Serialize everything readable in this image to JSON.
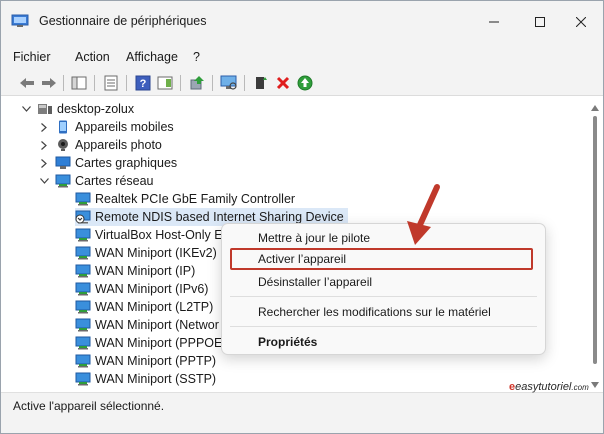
{
  "window": {
    "title": "Gestionnaire de périphériques"
  },
  "menubar": {
    "items": [
      "Fichier",
      "Action",
      "Affichage",
      "?"
    ]
  },
  "toolbar": {
    "icons": [
      "back-icon",
      "forward-icon",
      "show-hide-tree-icon",
      "properties-icon",
      "help-icon",
      "view-icon",
      "update-driver-icon",
      "scan-hardware-icon",
      "enable-device-icon",
      "uninstall-icon",
      "add-driver-icon"
    ]
  },
  "tree": {
    "root": "desktop-zolux",
    "categories": [
      {
        "label": "Appareils mobiles",
        "expanded": false
      },
      {
        "label": "Appareils photo",
        "expanded": false
      },
      {
        "label": "Cartes graphiques",
        "expanded": false
      },
      {
        "label": "Cartes réseau",
        "expanded": true
      }
    ],
    "network_devices": [
      "Realtek PCIe GbE Family Controller",
      "Remote NDIS based Internet Sharing Device",
      "VirtualBox Host-Only Et",
      "WAN Miniport (IKEv2)",
      "WAN Miniport (IP)",
      "WAN Miniport (IPv6)",
      "WAN Miniport (L2TP)",
      "WAN Miniport (Networ",
      "WAN Miniport (PPPOE)",
      "WAN Miniport (PPTP)",
      "WAN Miniport (SSTP)"
    ]
  },
  "context_menu": {
    "items": [
      "Mettre à jour le pilote",
      "Activer l’appareil",
      "Désinstaller l’appareil",
      "Rechercher les modifications sur le matériel",
      "Propriétés"
    ]
  },
  "status": {
    "text": "Active l'appareil sélectionné."
  },
  "watermark": {
    "text": "easytutoriel",
    "suffix": ".com"
  },
  "colors": {
    "accent_red": "#c0392b",
    "selection": "#dbe8f7",
    "chrome": "#f3f3f3"
  }
}
